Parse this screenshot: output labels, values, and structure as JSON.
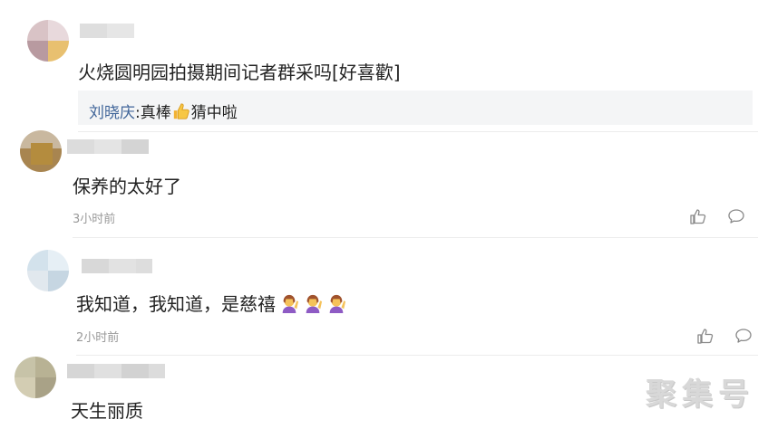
{
  "comments": [
    {
      "text": "火烧圆明园拍摄期间记者群采吗[好喜歡]",
      "reply": {
        "name": "刘晓庆",
        "sep": ":",
        "before_emoji": "真棒",
        "after_emoji": "猜中啦"
      }
    },
    {
      "text": "保养的太好了",
      "time": "3小时前"
    },
    {
      "text": "我知道，我知道，是慈禧",
      "time": "2小时前"
    },
    {
      "text": "天生丽质"
    }
  ],
  "watermark": "聚集号",
  "icons": [
    "thumbs-up-icon",
    "comment-icon"
  ]
}
